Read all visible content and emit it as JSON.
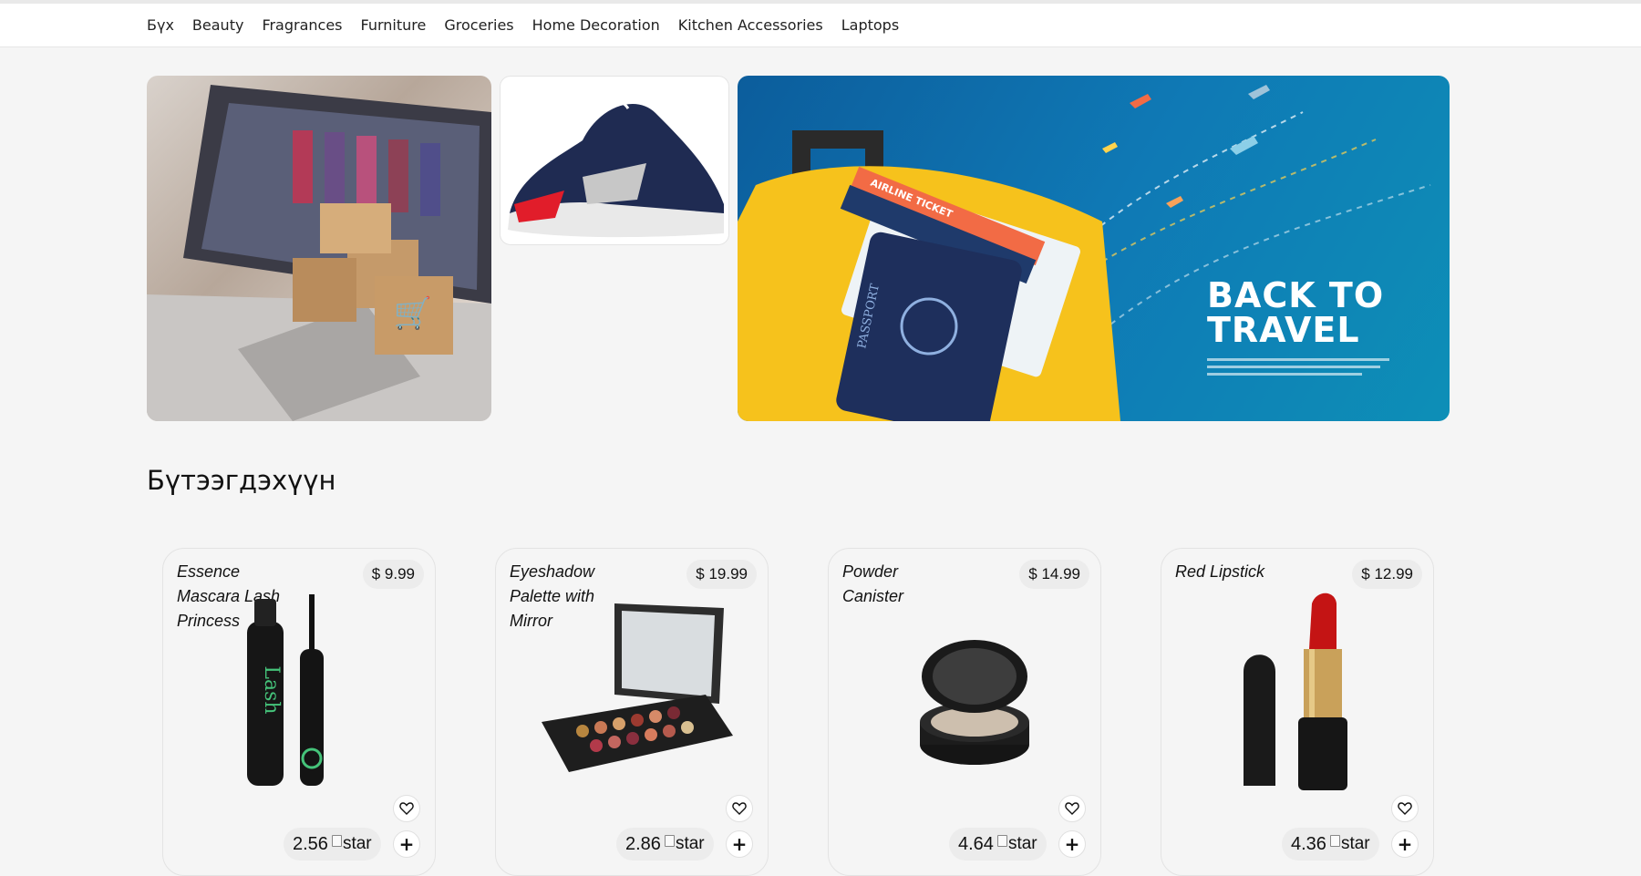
{
  "nav": {
    "items": [
      "Бүх",
      "Beauty",
      "Fragrances",
      "Furniture",
      "Groceries",
      "Home Decoration",
      "Kitchen Accessories",
      "Laptops"
    ]
  },
  "banners": {
    "travel_heading": "BACK TO TRAVEL",
    "ticket_text": "AIRLINE TICKET",
    "passport_text": "PASSPORT"
  },
  "section": {
    "title": "Бүтээгдэхүүн"
  },
  "products": [
    {
      "name": "Essence Mascara Lash Princess",
      "price": "$ 9.99",
      "rating": "2.56",
      "star_alt": "star",
      "image": "mascara"
    },
    {
      "name": "Eyeshadow Palette with Mirror",
      "price": "$ 19.99",
      "rating": "2.86",
      "star_alt": "star",
      "image": "eyeshadow-palette"
    },
    {
      "name": "Powder Canister",
      "price": "$ 14.99",
      "rating": "4.64",
      "star_alt": "star",
      "image": "powder-canister"
    },
    {
      "name": "Red Lipstick",
      "price": "$ 12.99",
      "rating": "4.36",
      "star_alt": "star",
      "image": "lipstick"
    }
  ],
  "icons": {
    "favorite": "heart-icon",
    "add": "plus-icon"
  },
  "colors": {
    "page_bg": "#f5f5f5",
    "travel_bg": "#0f79b5",
    "travel_case": "#f6c21c"
  }
}
